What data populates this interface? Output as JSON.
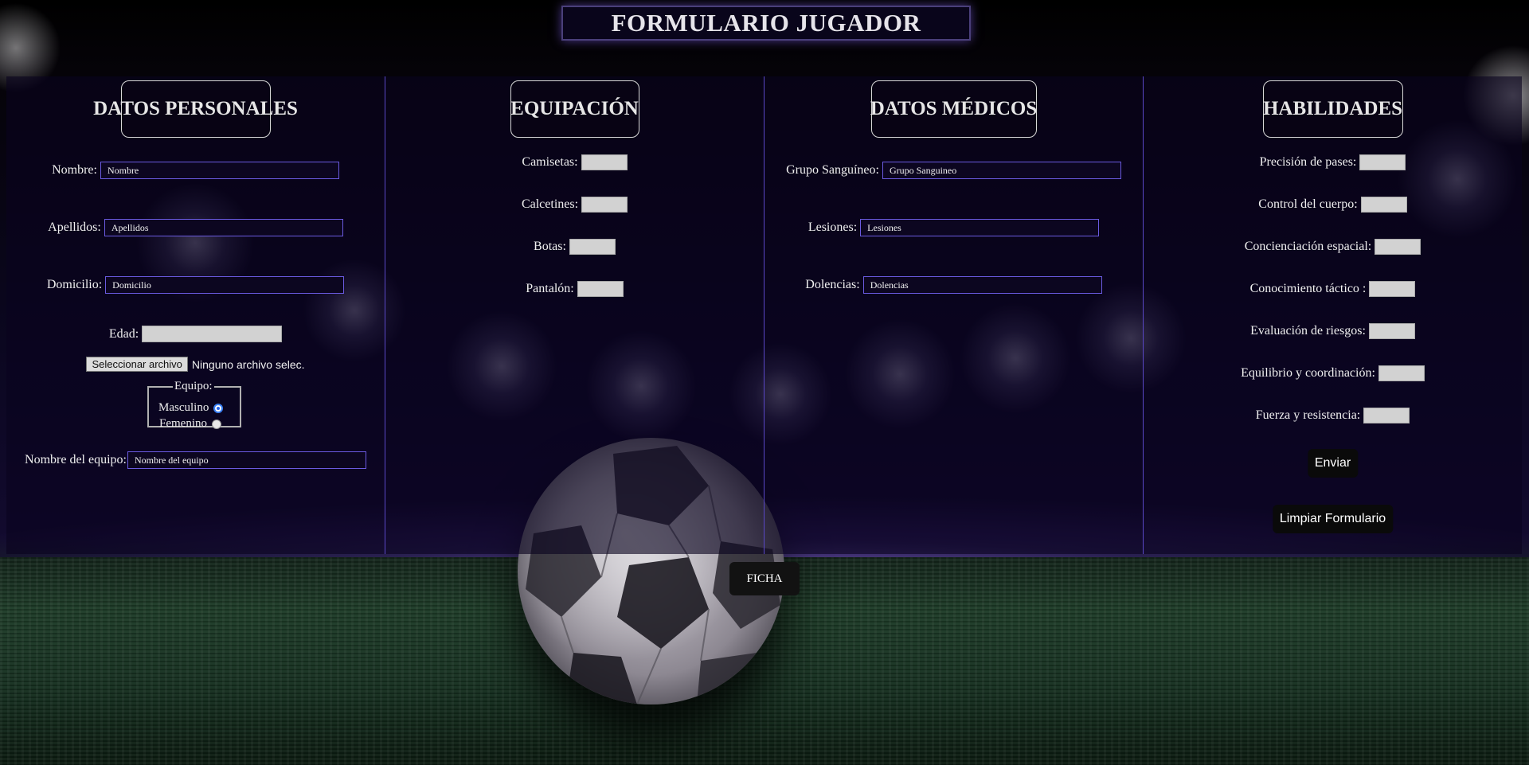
{
  "header": {
    "title": "FORMULARIO JUGADOR"
  },
  "personal": {
    "heading": "DATOS PERSONALES",
    "nombre_label": "Nombre:",
    "nombre_value": "Nombre",
    "apellidos_label": "Apellidos:",
    "apellidos_value": "Apellidos",
    "domicilio_label": "Domicilio:",
    "domicilio_value": "Domicilio",
    "edad_label": "Edad:",
    "file_button": "Seleccionar archivo",
    "file_status": "Ninguno archivo selec.",
    "equipo_legend": "Equipo:",
    "masculino": "Masculino",
    "femenino": "Femenino",
    "selected_team": "Masculino",
    "nombre_equipo_label": "Nombre del equipo:",
    "nombre_equipo_value": "Nombre del equipo"
  },
  "equipacion": {
    "heading": "EQUIPACIÓN",
    "camisetas": "Camisetas:",
    "calcetines": "Calcetines:",
    "botas": "Botas:",
    "pantalon": "Pantalón:"
  },
  "medicos": {
    "heading": "DATOS MÉDICOS",
    "grupo_label": "Grupo Sanguíneo:",
    "grupo_value": "Grupo Sanguineo",
    "lesiones_label": "Lesiones:",
    "lesiones_value": "Lesiones",
    "dolencias_label": "Dolencias:",
    "dolencias_value": "Dolencias"
  },
  "habilidades": {
    "heading": "HABILIDADES",
    "items": [
      "Precisión de pases:",
      "Control del cuerpo:",
      "Concienciación espacial:",
      "Conocimiento táctico :",
      "Evaluación de riesgos:",
      "Equilibrio y coordinación:",
      "Fuerza y resistencia:"
    ],
    "submit": "Enviar",
    "reset": "Limpiar Formulario"
  },
  "footer": {
    "ficha": "FICHA"
  }
}
